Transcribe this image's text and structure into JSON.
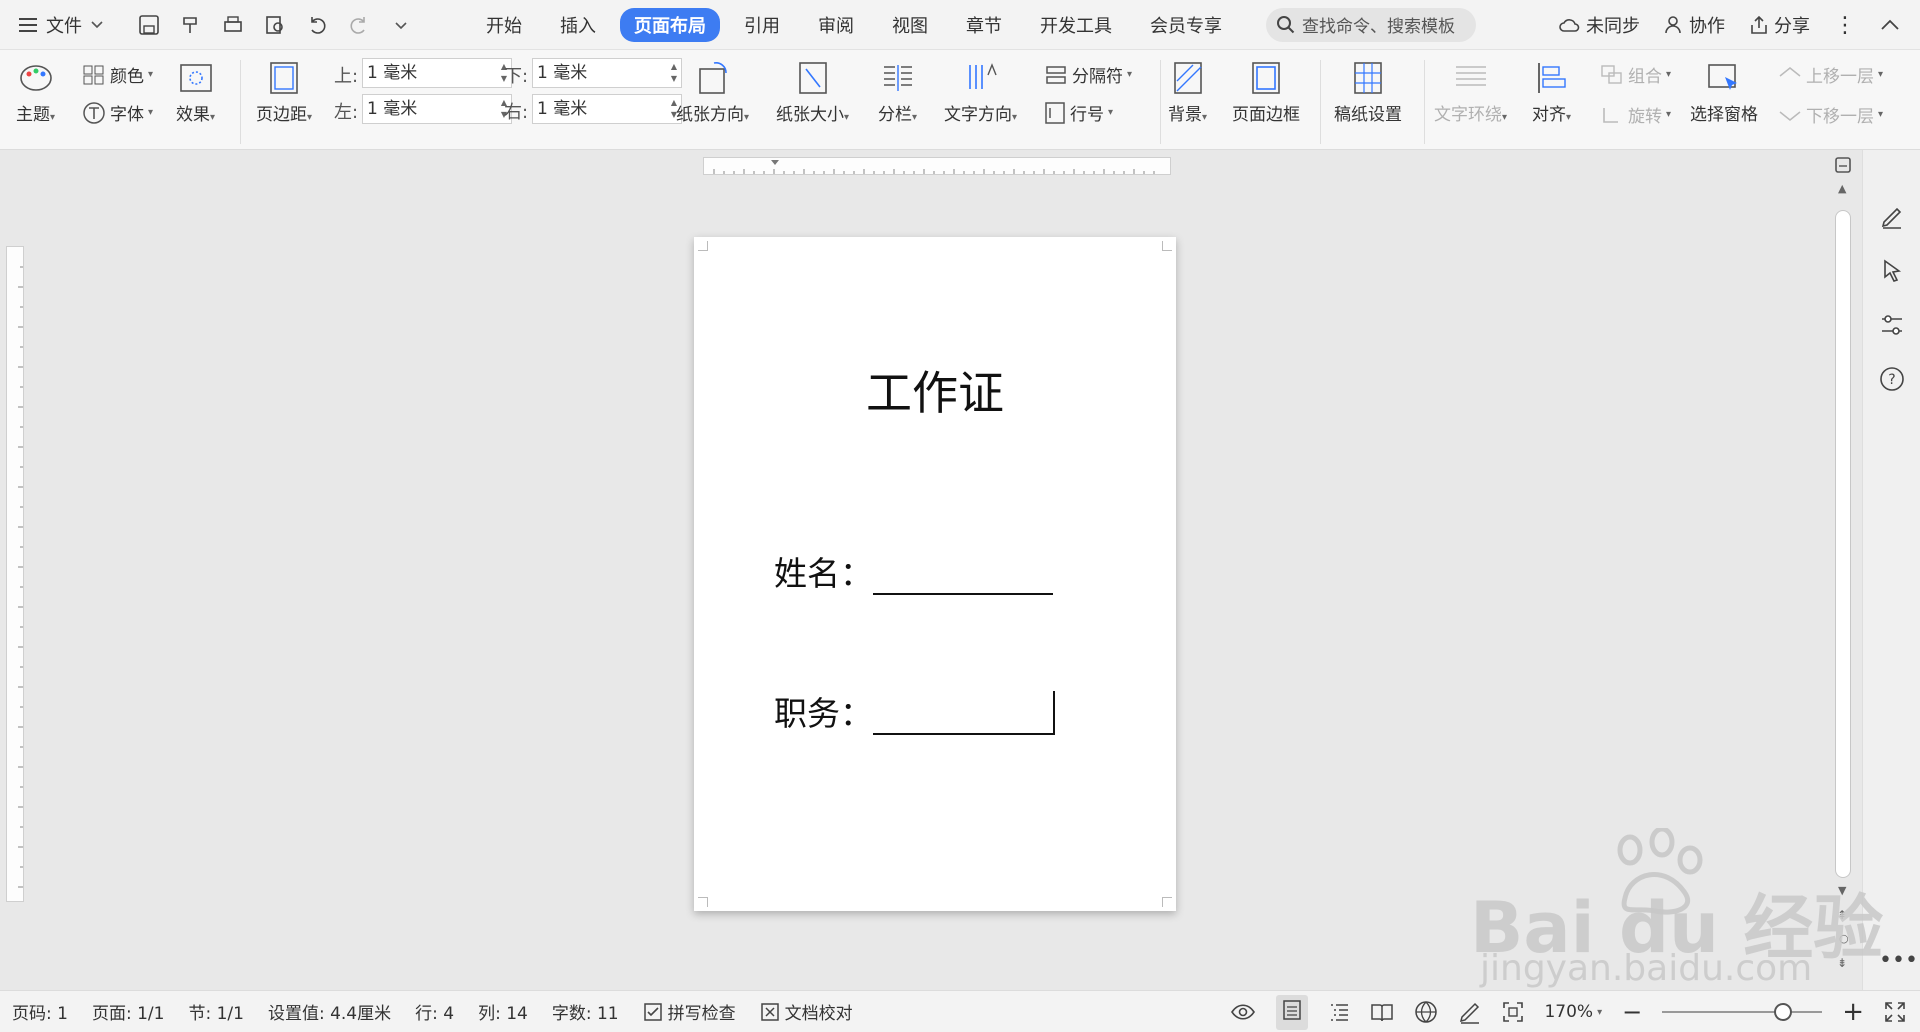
{
  "tabbar": {
    "file_label": "文件",
    "tabs": [
      "开始",
      "插入",
      "页面布局",
      "引用",
      "审阅",
      "视图",
      "章节",
      "开发工具",
      "会员专享"
    ],
    "active_tab": "页面布局",
    "search_placeholder": "查找命令、搜索模板",
    "sync_label": "未同步",
    "collab_label": "协作",
    "share_label": "分享"
  },
  "ribbon": {
    "theme": "主题",
    "color": "颜色",
    "font": "字体",
    "effect": "效果",
    "margins": "页边距",
    "margin_top_label": "上:",
    "margin_bottom_label": "下:",
    "margin_left_label": "左:",
    "margin_right_label": "右:",
    "margin_top": "1 毫米",
    "margin_bottom": "1 毫米",
    "margin_left": "1 毫米",
    "margin_right": "1 毫米",
    "orientation": "纸张方向",
    "size": "纸张大小",
    "columns": "分栏",
    "text_direction": "文字方向",
    "breaks": "分隔符",
    "line_numbers": "行号",
    "background": "背景",
    "page_border": "页面边框",
    "manuscript": "稿纸设置",
    "wrap_text": "文字环绕",
    "align": "对齐",
    "group": "组合",
    "rotate": "旋转",
    "selection_pane": "选择窗格",
    "bring_forward": "上移一层",
    "send_backward": "下移一层"
  },
  "document": {
    "title": "工作证",
    "name_label": "姓名：",
    "position_label": "职务："
  },
  "status": {
    "page_no": "页码: 1",
    "pages": "页面: 1/1",
    "section": "节: 1/1",
    "setting": "设置值: 4.4厘米",
    "row": "行: 4",
    "col": "列: 14",
    "words": "字数: 11",
    "spell": "拼写检查",
    "proof": "文档校对",
    "zoom": "170%",
    "zoom_level_percent": 170
  },
  "watermark": {
    "brand": "Bai du 经验",
    "url": "jingyan.baidu.com"
  },
  "colors": {
    "accent": "#3d7cf2",
    "ribbon_bg": "#f7f7f7",
    "canvas_bg": "#e8e8e8"
  }
}
